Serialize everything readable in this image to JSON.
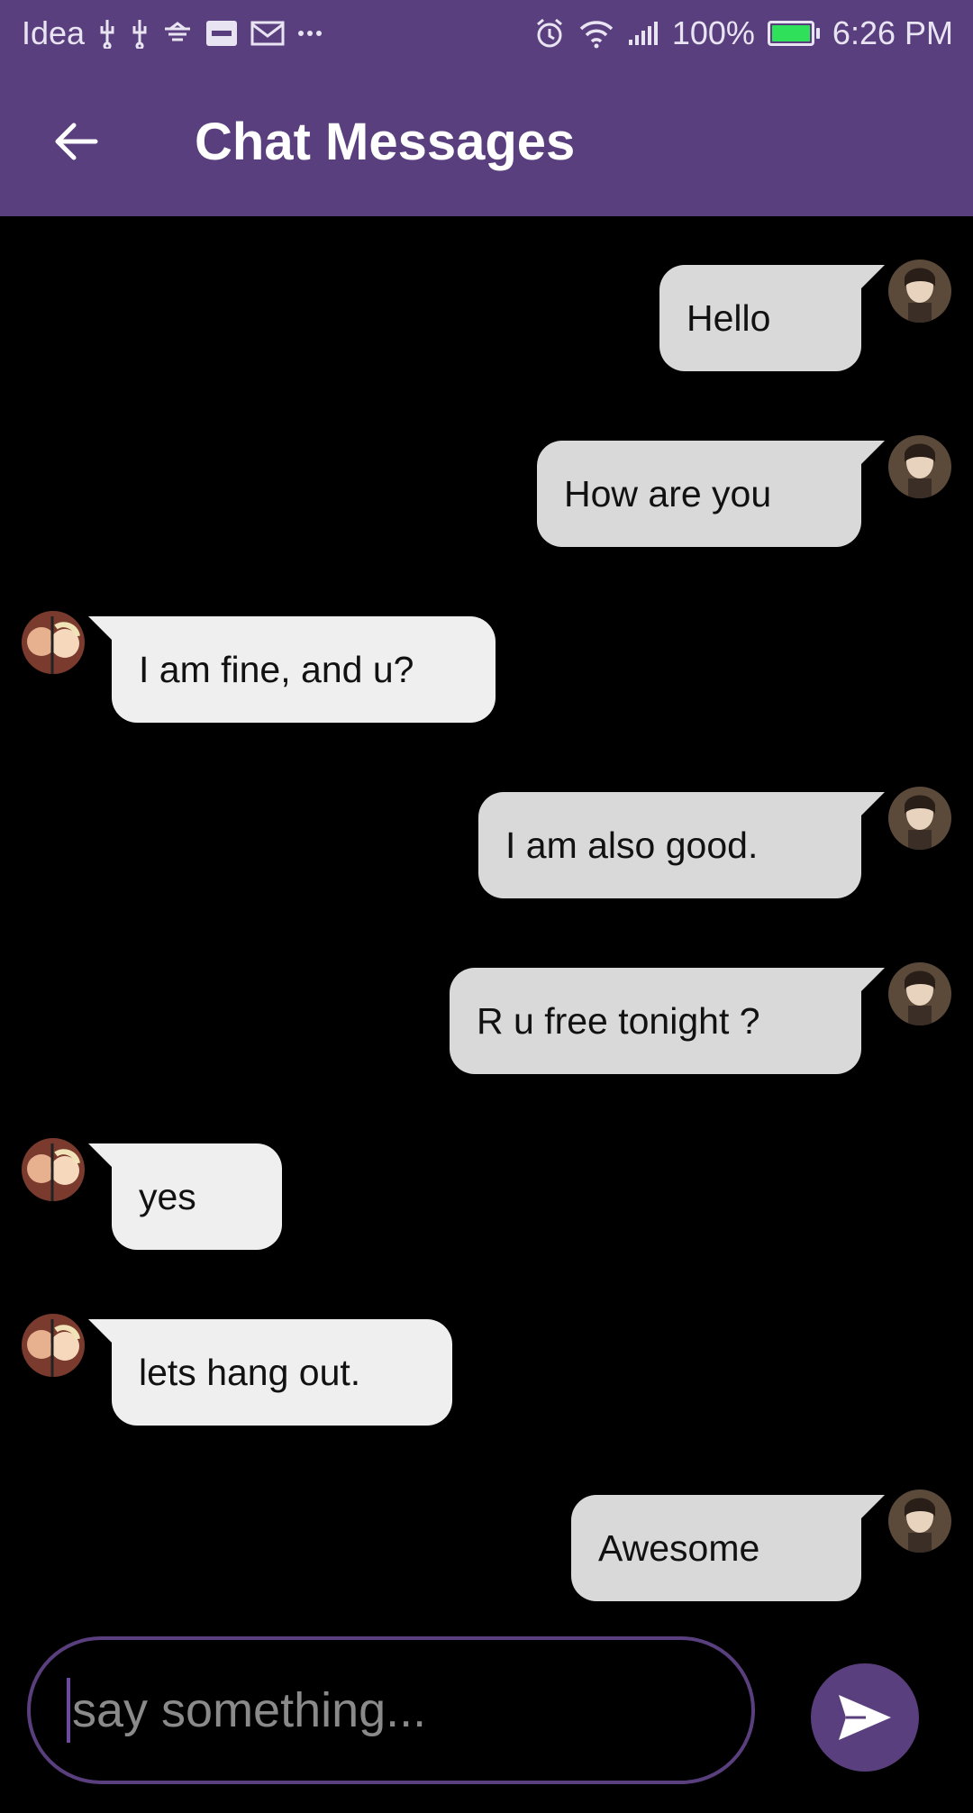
{
  "status_bar": {
    "carrier": "Idea",
    "battery_percent": "100%",
    "battery_level": 1.0,
    "time": "6:26 PM",
    "left_icons": [
      "usb-icon",
      "usb-icon",
      "cast-icon",
      "paytm-icon",
      "gmail-icon",
      "more-dots-icon"
    ],
    "right_icons": [
      "alarm-icon",
      "wifi-icon",
      "signal-icon",
      "battery-icon"
    ]
  },
  "app_bar": {
    "title": "Chat Messages",
    "back_icon": "arrow-back-icon"
  },
  "messages": [
    {
      "side": "sent",
      "text": "Hello"
    },
    {
      "side": "sent",
      "text": "How are you"
    },
    {
      "side": "received",
      "text": "I am fine, and u?"
    },
    {
      "side": "sent",
      "text": "I am also good."
    },
    {
      "side": "sent",
      "text": "R u free tonight  ?"
    },
    {
      "side": "received",
      "text": "yes"
    },
    {
      "side": "received",
      "text": "lets hang out."
    },
    {
      "side": "sent",
      "text": "Awesome"
    }
  ],
  "composer": {
    "placeholder": "say something...",
    "value": "",
    "send_icon": "send-icon"
  },
  "colors": {
    "primary": "#5a3f7e",
    "background": "#000000",
    "sent_bubble": "#d9d9d9",
    "received_bubble": "#efefef",
    "battery": "#2ee05a"
  }
}
